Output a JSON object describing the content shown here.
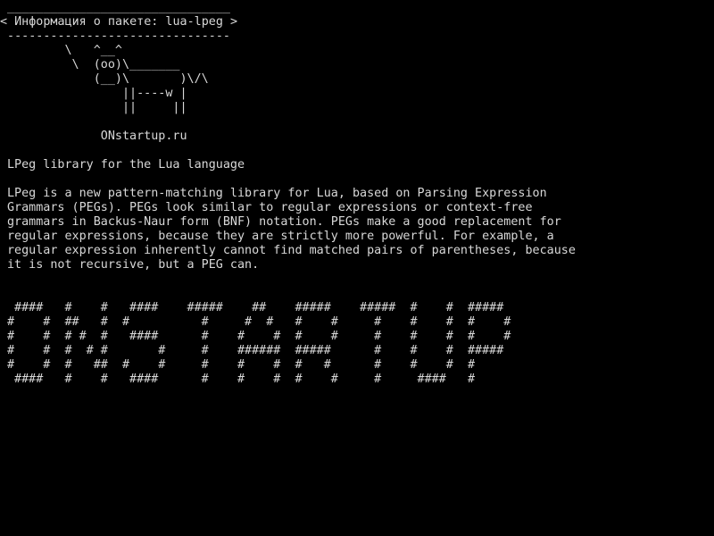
{
  "terminal": {
    "lines": [
      " _______________________________",
      "< Информация о пакете: lua-lpeg >",
      " -------------------------------",
      "        \\   ^__^",
      "         \\  (oo)\\_______",
      "            (__)\\       )\\/\\",
      "                ||----w |",
      "                ||     ||",
      "",
      "             ONstartup.ru",
      "",
      "LPeg library for the Lua language",
      "",
      "LPeg is a new pattern-matching library for Lua, based on Parsing Expression",
      "Grammars (PEGs). PEGs look similar to regular expressions or context-free",
      "grammars in Backus-Naur form (BNF) notation. PEGs make a good replacement for",
      "regular expressions, because they are strictly more powerful. For example, a",
      "regular expression inherently cannot find matched pairs of parentheses, because",
      "it is not recursive, but a PEG can.",
      "",
      "",
      " ####   #    #   ####    #####    ##    #####    #####  #    #  #####",
      "#    #  ##   #  #          #     #  #   #    #     #    #    #  #    #",
      "#    #  # #  #   ####      #    #    #  #    #     #    #    #  #    #",
      "#    #  #  # #       #     #    ######  #####      #    #    #  #####",
      "#    #  #   ##  #    #     #    #    #  #   #      #    #    #  #",
      " ####   #    #   ####      #    #    #  #    #     #     ####   #"
    ]
  }
}
